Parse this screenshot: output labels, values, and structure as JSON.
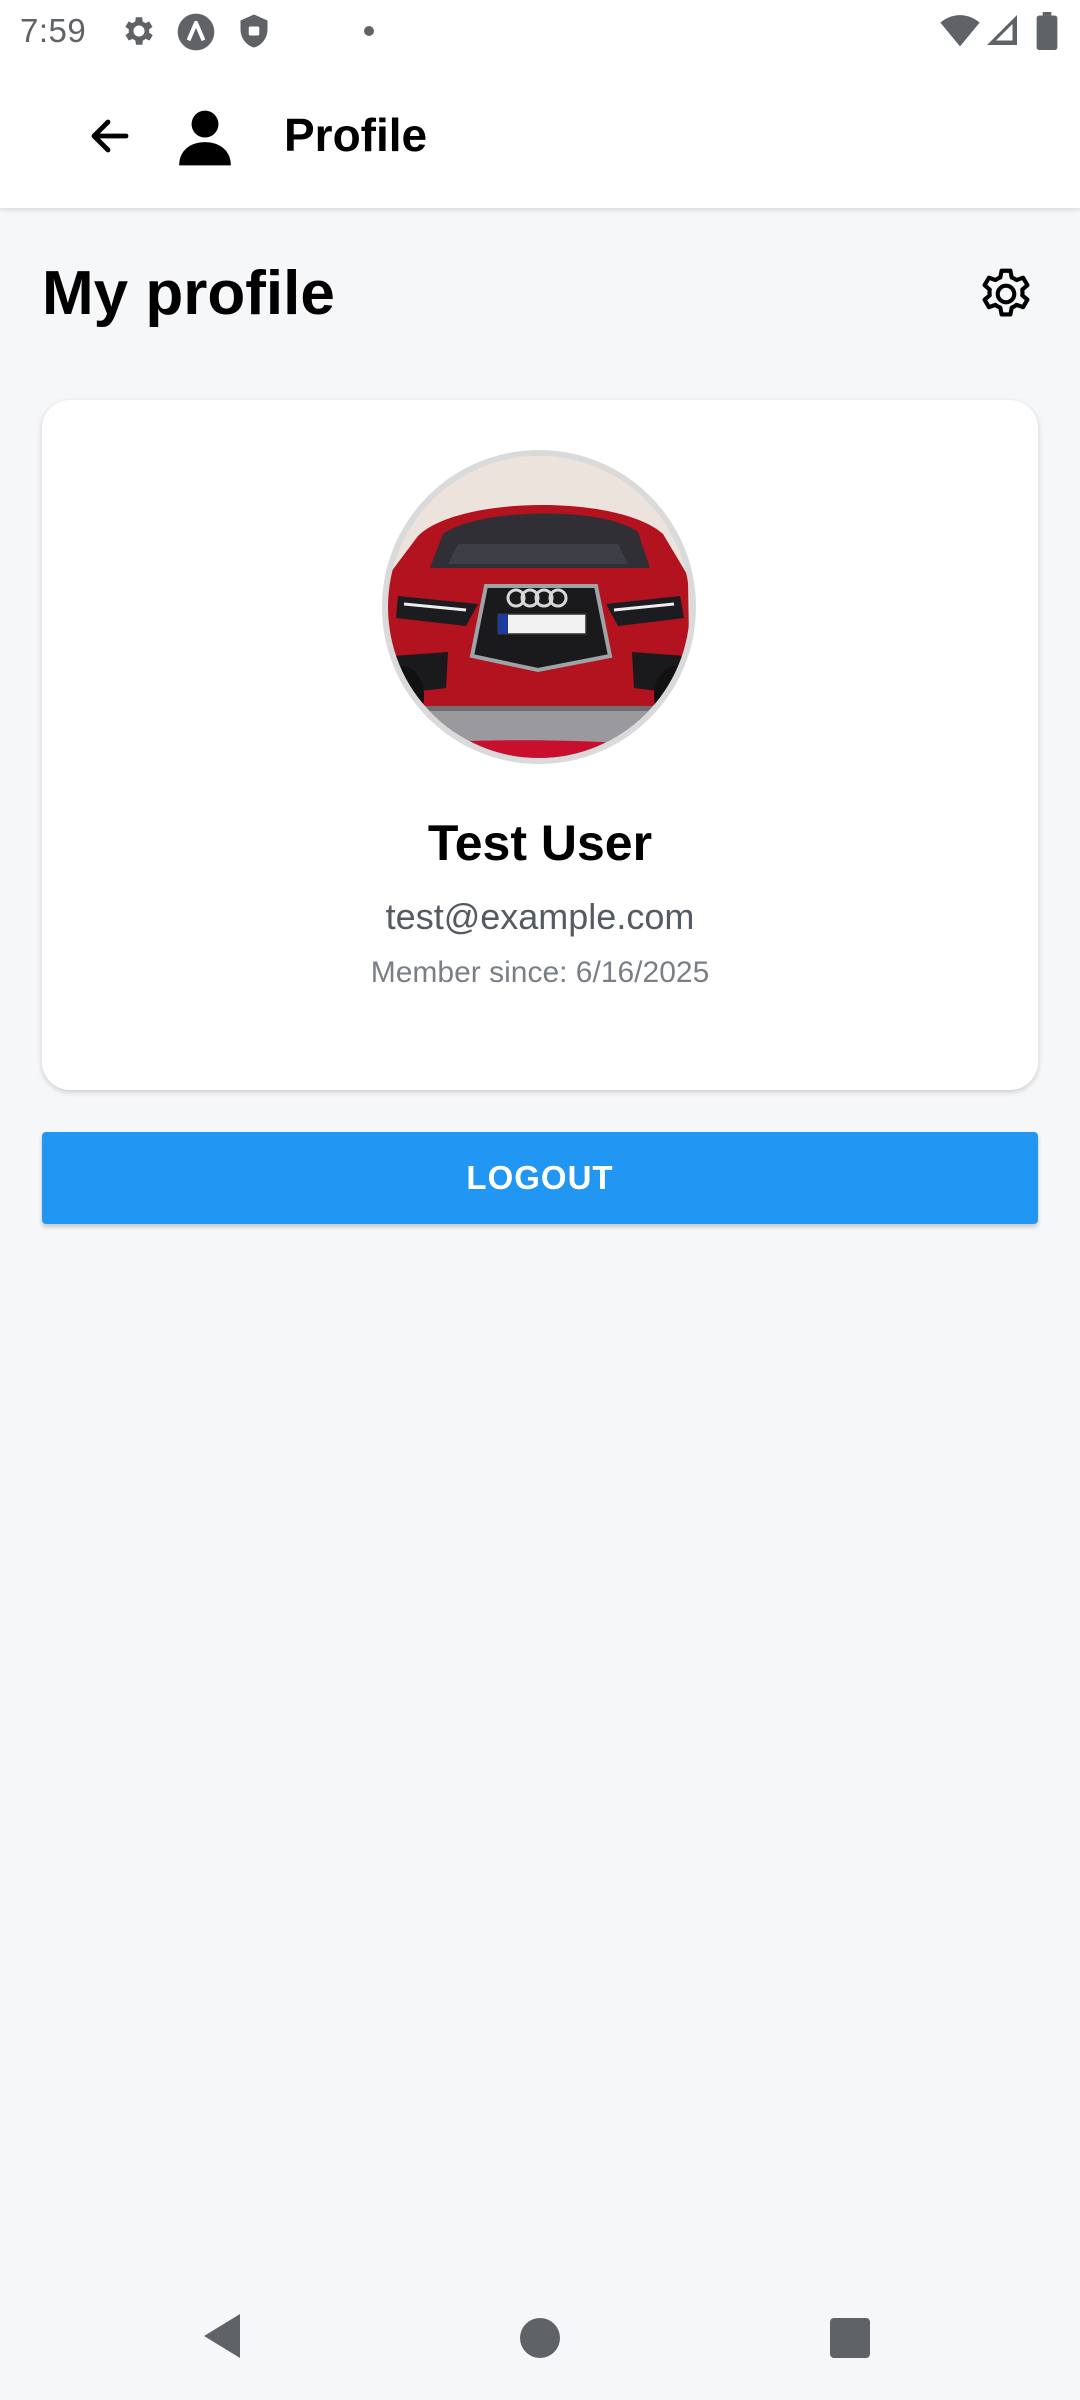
{
  "status_bar": {
    "time": "7:59",
    "icons": [
      "gear-icon",
      "a-icon",
      "shield-icon",
      "dot-icon",
      "wifi-icon",
      "signal-icon",
      "battery-icon"
    ]
  },
  "app_bar": {
    "title": "Profile",
    "back_icon": "arrow-left-icon",
    "person_icon": "person-icon"
  },
  "header": {
    "title": "My profile",
    "settings_icon": "gear-icon"
  },
  "profile": {
    "name": "Test User",
    "email": "test@example.com",
    "member_since": "Member since: 6/16/2025",
    "avatar": "red-car-photo"
  },
  "logout_label": "LOGOUT",
  "nav_bar": {
    "icons": [
      "nav-back-icon",
      "nav-home-icon",
      "nav-recents-icon"
    ]
  },
  "colors": {
    "accent": "#2196F3",
    "background": "#F6F7F9",
    "card": "#FFFFFF"
  }
}
